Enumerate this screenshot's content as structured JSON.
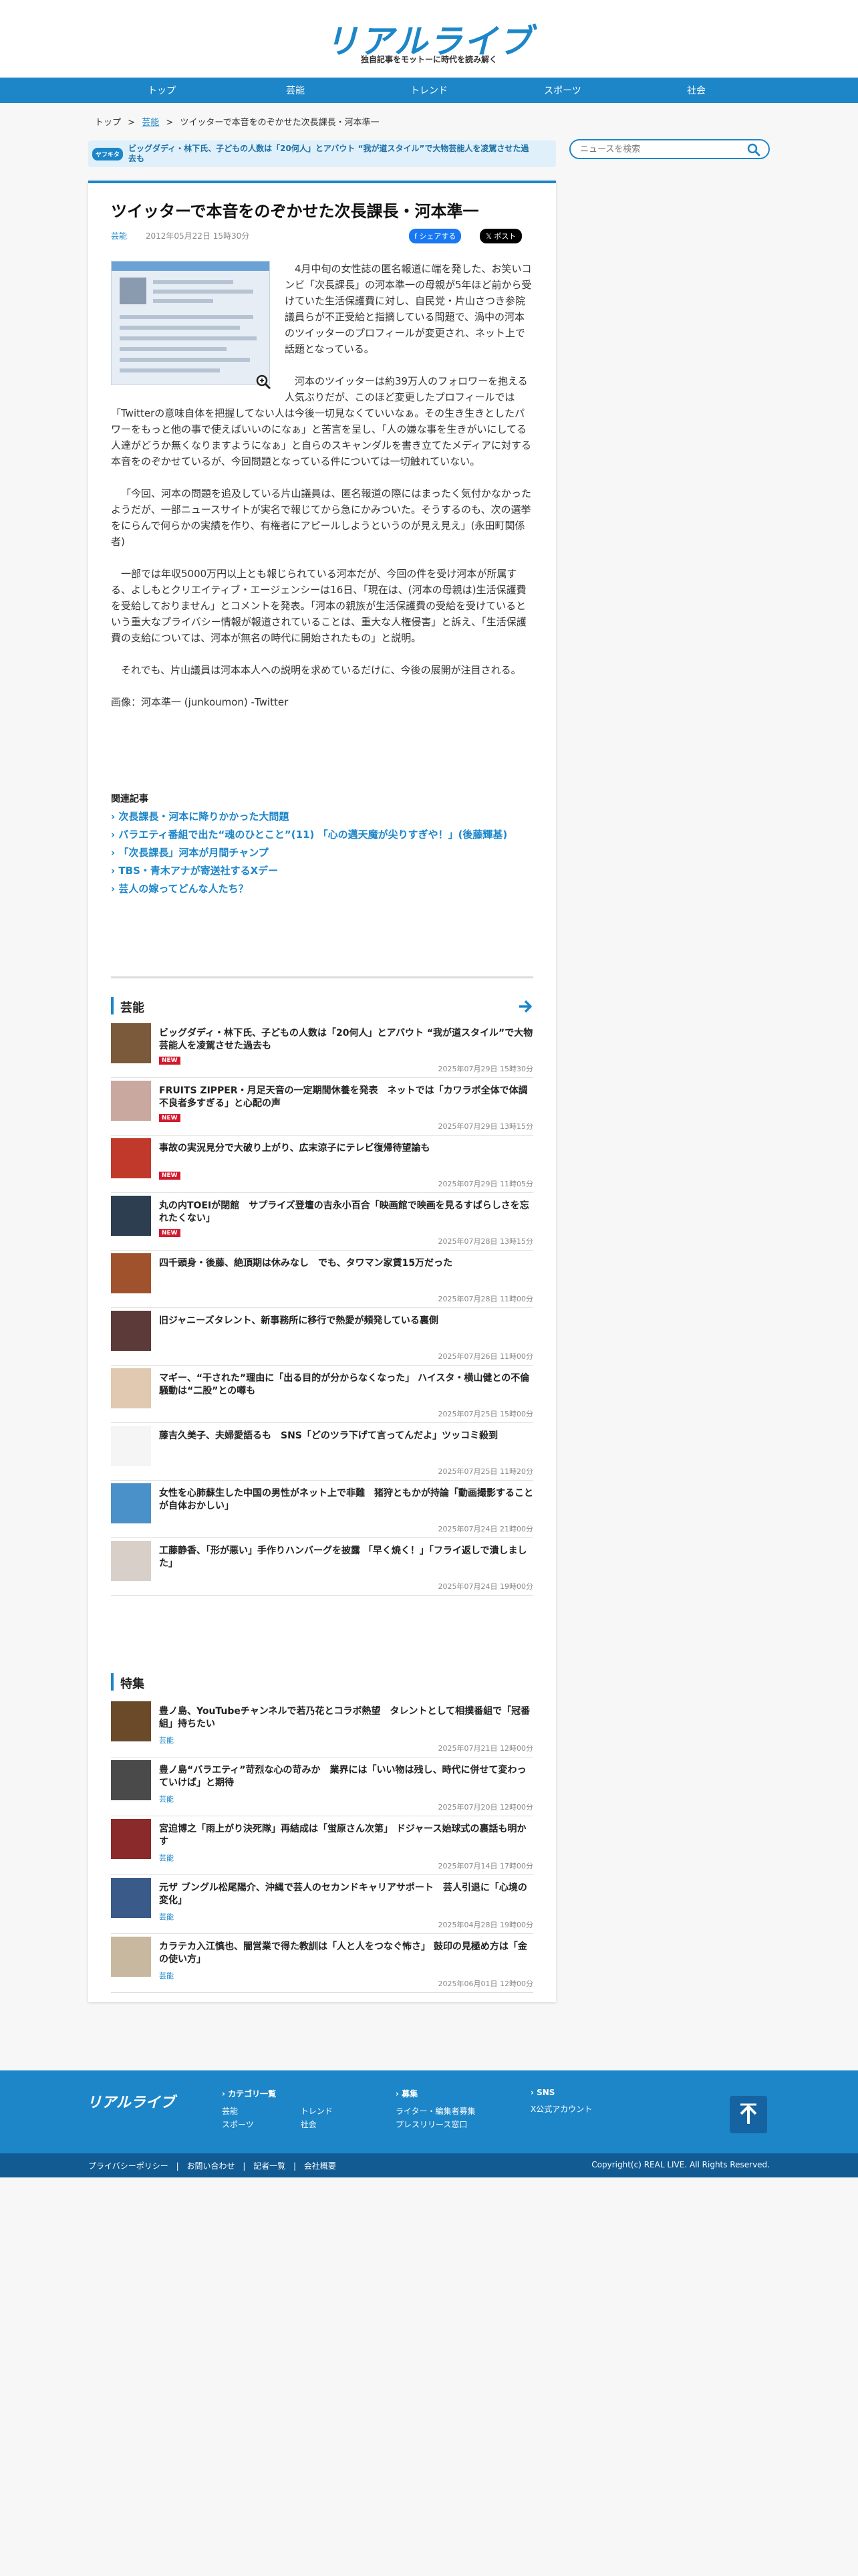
{
  "header": {
    "logo": "リアルライブ",
    "tagline": "独自記事をモットーに時代を読み解く",
    "nav": [
      "トップ",
      "芸能",
      "トレンド",
      "スポーツ",
      "社会"
    ]
  },
  "breadcrumb": {
    "items": [
      "トップ",
      "芸能"
    ],
    "current": "ツイッターで本音をのぞかせた次長課長・河本準一",
    "separator": ">"
  },
  "ticker": {
    "badge": "ヤフキタ",
    "text": "ビッグダディ・林下氏、子どもの人数は「20何人」とアバウト “我が道スタイル”で大物芸能人を凌駕させた過去も"
  },
  "search": {
    "placeholder": "ニュースを検索"
  },
  "article": {
    "title": "ツイッターで本音をのぞかせた次長課長・河本準一",
    "category": "芸能",
    "date": "2012年05月22日 15時30分",
    "share_fb": "シェアする",
    "share_x": "ポスト",
    "paragraphs": [
      "4月中旬の女性誌の匿名報道に端を発した、お笑いコンビ「次長課長」の河本準一の母親が5年ほど前から受けていた生活保護費に対し、自民党・片山さつき参院議員らが不正受給と指摘している問題で、渦中の河本のツイッターのプロフィールが変更され、ネット上で話題となっている。",
      "河本のツイッターは約39万人のフォロワーを抱える人気ぶりだが、このほど変更したプロフィールでは「Twitterの意味自体を把握してない人は今後一切見なくていいなぁ。その生き生きとしたパワーをもっと他の事で使えばいいのになぁ」と苦言を呈し、「人の嫌な事を生きがいにしてる人達がどうか無くなりますようになぁ」と自らのスキャンダルを書き立てたメディアに対する本音をのぞかせているが、今回問題となっている件については一切触れていない。",
      "「今回、河本の問題を追及している片山議員は、匿名報道の際にはまったく気付かなかったようだが、一部ニュースサイトが実名で報じてから急にかみついた。そうするのも、次の選挙をにらんで何らかの実績を作り、有権者にアピールしようというのが見え見え」(永田町関係者)",
      "一部では年収5000万円以上とも報じられている河本だが、今回の件を受け河本が所属する、よしもとクリエイティブ・エージェンシーは16日、「現在は、(河本の母親は)生活保護費を受給しておりません」とコメントを発表。「河本の親族が生活保護費の受給を受けているという重大なプライバシー情報が報道されていることは、重大な人権侵害」と訴え、「生活保護費の支給については、河本が無名の時代に開始されたもの」と説明。",
      "それでも、片山議員は河本本人への説明を求めているだけに、今後の展開が注目される。",
      "画像：河本準一 (junkoumon) -Twitter"
    ]
  },
  "related": {
    "title": "関連記事",
    "items": [
      "› 次長課長・河本に降りかかった大問題",
      "› バラエティ番組で出た“魂のひとこと”(11) 「心の邁天魔が尖りすぎや！」(後藤輝基)",
      "› 「次長課長」河本が月間チャンプ",
      "› TBS・青木アナが寄送社するXデー",
      "› 芸人の嫁ってどんな人たち？"
    ]
  },
  "geino": {
    "title": "芸能",
    "items": [
      {
        "title": "ビッグダディ・林下氏、子どもの人数は「20何人」とアバウト “我が道スタイル”で大物芸能人を凌駕させた過去も",
        "badge": "NEW",
        "date": "2025年07月29日 15時30分",
        "color": "#7a5a3a"
      },
      {
        "title": "FRUITS ZIPPER・月足天音の一定期間休養を発表　ネットでは「カワラボ全体で体調不良者多すぎる」と心配の声",
        "badge": "NEW",
        "date": "2025年07月29日 13時15分",
        "color": "#c9a8a0"
      },
      {
        "title": "事故の実況見分で大破り上がり、広末涼子にテレビ復帰待望論も",
        "badge": "NEW",
        "date": "2025年07月29日 11時05分",
        "color": "#c0392b"
      },
      {
        "title": "丸の内TOEIが閉館　サプライズ登壇の吉永小百合「映画館で映画を見るすばらしさを忘れたくない」",
        "badge": "NEW",
        "date": "2025年07月28日 13時15分",
        "color": "#2c3e50"
      },
      {
        "title": "四千頭身・後藤、絶頂期は休みなし　でも、タワマン家賃15万だった",
        "badge": "",
        "date": "2025年07月28日 11時00分",
        "color": "#a0522d"
      },
      {
        "title": "旧ジャニーズタレント、新事務所に移行で熱愛が頻発している裏側",
        "badge": "",
        "date": "2025年07月26日 11時00分",
        "color": "#5d3a3a"
      },
      {
        "title": "マギー、“干された”理由に「出る目的が分からなくなった」 ハイスタ・横山健との不倫騒動は“二股”との噂も",
        "badge": "",
        "date": "2025年07月25日 15時00分",
        "color": "#e0c9b0"
      },
      {
        "title": "藤吉久美子、夫婦愛語るも　SNS「どのツラ下げて言ってんだよ」ツッコミ殺到",
        "badge": "",
        "date": "2025年07月25日 11時20分",
        "color": "#f5f5f5"
      },
      {
        "title": "女性を心肺蘇生した中国の男性がネット上で非難　猪狩ともかが持論「動画撮影することが自体おかしい」",
        "badge": "",
        "date": "2025年07月24日 21時00分",
        "color": "#4a90c9"
      },
      {
        "title": "工藤静香、「形が悪い」手作りハンバーグを披露 「早く焼く！」「フライ返しで潰しました」",
        "badge": "",
        "date": "2025年07月24日 19時00分",
        "color": "#d8d0c8"
      }
    ]
  },
  "tokushu": {
    "title": "特集",
    "items": [
      {
        "title": "豊ノ島、YouTubeチャンネルで若乃花とコラボ熱望　タレントとして相撲番組で「冠番組」持ちたい",
        "badge": "芸能",
        "date": "2025年07月21日 12時00分",
        "color": "#6b4a2a"
      },
      {
        "title": "豊ノ島“バラエティ”苛烈な心の苛みか　業界には「いい物は残し、時代に併せて変わっていけば」と期待",
        "badge": "芸能",
        "date": "2025年07月20日 12時00分",
        "color": "#4a4a4a"
      },
      {
        "title": "宮迫博之「雨上がり決死隊」再結成は「蛍原さん次第」 ドジャース始球式の裏話も明かす",
        "badge": "芸能",
        "date": "2025年07月14日 17時00分",
        "color": "#8a2a2a"
      },
      {
        "title": "元ザ ブングル松尾陽介、沖縄で芸人のセカンドキャリアサポート　芸人引退に「心境の変化」",
        "badge": "芸能",
        "date": "2025年04月28日 19時00分",
        "color": "#3a5a8a"
      },
      {
        "title": "カラテカ入江慎也、闇営業で得た教訓は「人と人をつなぐ怖さ」 鼓印の見極め方は「金の使い方」",
        "badge": "芸能",
        "date": "2025年06月01日 12時00分",
        "color": "#c8b8a0"
      }
    ]
  },
  "footer": {
    "logo": "リアルライブ",
    "col1_head": "› カテゴリ一覧",
    "col1_links": [
      "芸能",
      "トレンド",
      "スポーツ",
      "社会"
    ],
    "col2_head": "› 募集",
    "col2_links": [
      "ライター・編集者募集",
      "プレスリリース窓口"
    ],
    "col3_head": "› SNS",
    "col3_links": [
      "X公式アカウント"
    ],
    "bottom_links": [
      "プライバシーポリシー",
      "|",
      "お問い合わせ",
      "|",
      "記者一覧",
      "|",
      "会社概要"
    ],
    "copyright": "Copyright(c) REAL LIVE. All Rights Reserved."
  }
}
